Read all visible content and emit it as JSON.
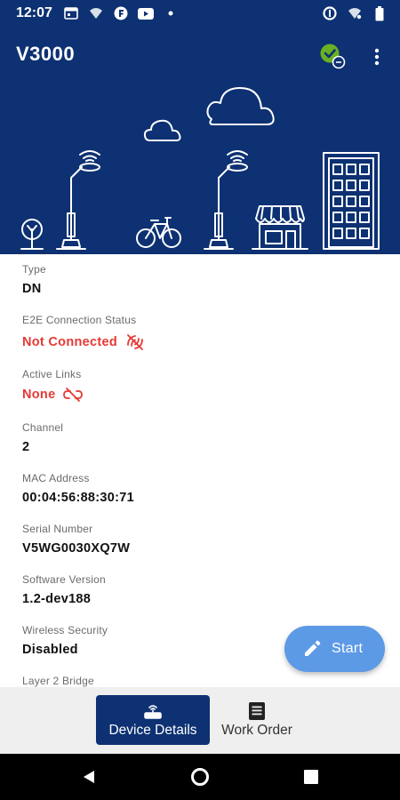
{
  "status_bar": {
    "time": "12:07"
  },
  "header": {
    "title": "V3000"
  },
  "details": [
    {
      "label": "Type",
      "value": "DN",
      "status": "normal"
    },
    {
      "label": "E2E Connection Status",
      "value": "Not Connected",
      "status": "error",
      "icon": "not-connected-icon"
    },
    {
      "label": "Active Links",
      "value": "None",
      "status": "error",
      "icon": "link-off-icon"
    },
    {
      "label": "Channel",
      "value": "2",
      "status": "normal"
    },
    {
      "label": "MAC Address",
      "value": "00:04:56:88:30:71",
      "status": "normal"
    },
    {
      "label": "Serial Number",
      "value": "V5WG0030XQ7W",
      "status": "normal"
    },
    {
      "label": "Software Version",
      "value": "1.2-dev188",
      "status": "normal"
    },
    {
      "label": "Wireless Security",
      "value": "Disabled",
      "status": "normal"
    },
    {
      "label": "Layer 2 Bridge",
      "value": "",
      "status": "normal"
    }
  ],
  "fab": {
    "label": "Start",
    "icon": "edit-pencil-icon"
  },
  "bottom_nav": {
    "tabs": [
      {
        "label": "Device Details",
        "icon": "router-icon",
        "active": true
      },
      {
        "label": "Work Order",
        "icon": "document-icon",
        "active": false
      }
    ]
  },
  "colors": {
    "primary": "#0d3172",
    "error": "#e53935",
    "success": "#6ab023",
    "fab": "#5d9ae6"
  }
}
